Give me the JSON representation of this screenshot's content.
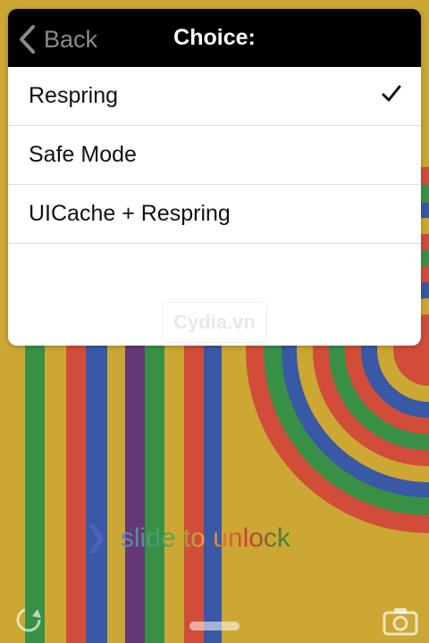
{
  "navbar": {
    "back_label": "Back",
    "title": "Choice:"
  },
  "options": [
    {
      "label": "Respring",
      "selected": true
    },
    {
      "label": "Safe Mode",
      "selected": false
    },
    {
      "label": "UICache + Respring",
      "selected": false
    }
  ],
  "watermark": "Cydia.vn",
  "lockscreen": {
    "slide_text": "slide to unlock"
  },
  "icons": {
    "back": "chevron-left-icon",
    "check": "checkmark-icon",
    "respring": "respring-icon",
    "camera": "camera-icon",
    "grabber": "grabber-handle"
  },
  "colors": {
    "navbar_bg": "#000000",
    "back_label": "#8a8a8a",
    "title": "#ffffff",
    "list_bg": "#ffffff",
    "separator": "#dcdcdc"
  }
}
